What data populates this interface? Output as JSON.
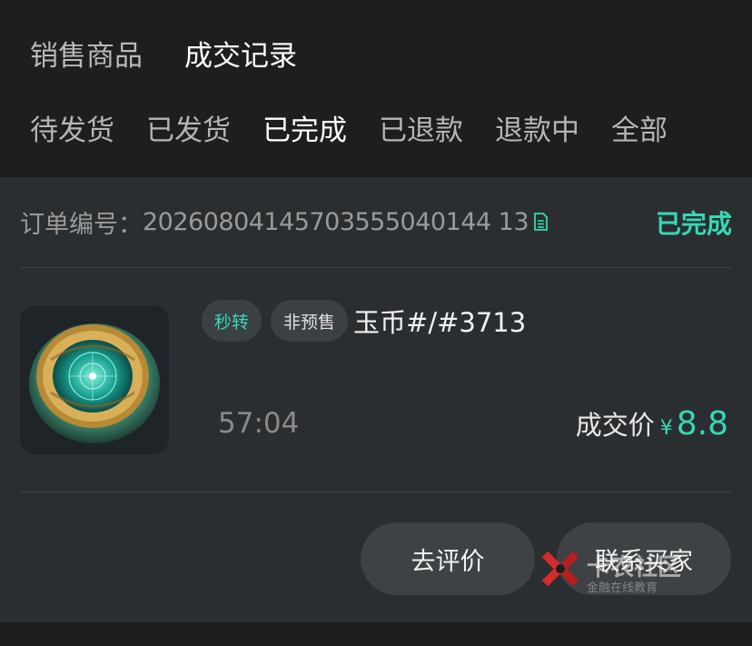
{
  "tabs_primary": [
    {
      "label": "销售商品",
      "active": false
    },
    {
      "label": "成交记录",
      "active": true
    }
  ],
  "tabs_status": [
    {
      "label": "待发货",
      "active": false
    },
    {
      "label": "已发货",
      "active": false
    },
    {
      "label": "已完成",
      "active": true
    },
    {
      "label": "已退款",
      "active": false
    },
    {
      "label": "退款中",
      "active": false
    },
    {
      "label": "全部",
      "active": false
    }
  ],
  "order": {
    "number_label": "订单编号：",
    "number": "20260804145703555040144 13",
    "status": "已完成",
    "tags": [
      "秒转",
      "非预售"
    ],
    "title": "玉币#/#3713",
    "time": "57:04",
    "price_label": "成交价",
    "currency": "¥",
    "price": "8.8",
    "thumb_icon": "jade-coin-image"
  },
  "actions": {
    "review": "去评价",
    "contact": "联系买家"
  },
  "watermark": {
    "text": "卡农社区",
    "sub": "金融在线教育",
    "icon": "kanong-logo-icon"
  },
  "colors": {
    "accent": "#36d8b4",
    "background": "#1c1e20",
    "card": "#2b2e31"
  }
}
